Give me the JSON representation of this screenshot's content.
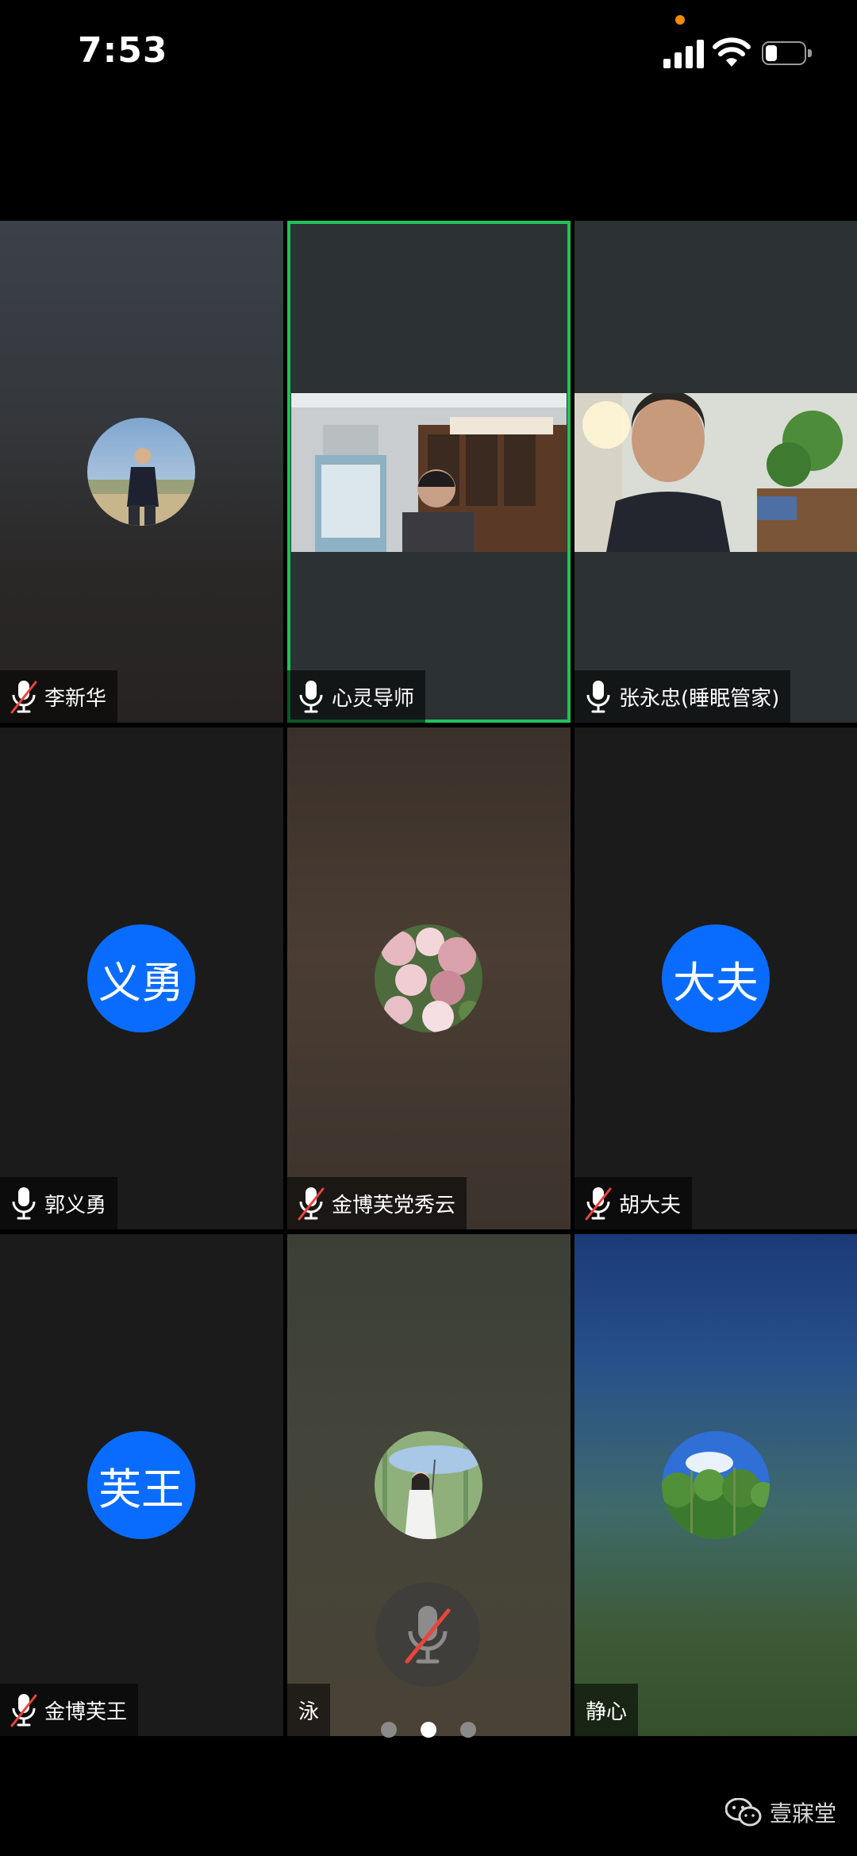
{
  "status_bar": {
    "time": "7:53",
    "battery_level": 0.3,
    "camera_indicator_color": "#f08a00"
  },
  "colors": {
    "active_speaker_border": "#1fc25b",
    "initials_avatar": "#0a6cff",
    "mute_slash": "#e8453c"
  },
  "participants": [
    {
      "name": "李新华",
      "mic": "muted",
      "display": "photo-avatar"
    },
    {
      "name": "心灵导师",
      "mic": "on",
      "display": "video",
      "active_speaker": true
    },
    {
      "name": "张永忠(睡眠管家)",
      "mic": "on",
      "display": "video"
    },
    {
      "name": "郭义勇",
      "mic": "on",
      "display": "initials",
      "initials": "义勇"
    },
    {
      "name": "金博芙党秀云",
      "mic": "muted",
      "display": "photo-avatar"
    },
    {
      "name": "胡大夫",
      "mic": "muted",
      "display": "initials",
      "initials": "大夫"
    },
    {
      "name": "金博芙王",
      "mic": "muted",
      "display": "initials",
      "initials": "芙王"
    },
    {
      "name": "泳",
      "mic": "none",
      "display": "photo-avatar"
    },
    {
      "name": "静心",
      "mic": "none",
      "display": "photo-avatar"
    }
  ],
  "controls": {
    "mute_button_icon": "mic-muted-icon",
    "page_count": 3,
    "current_page": 2
  },
  "watermark": {
    "icon": "wechat-icon",
    "text": "壹寐堂"
  }
}
